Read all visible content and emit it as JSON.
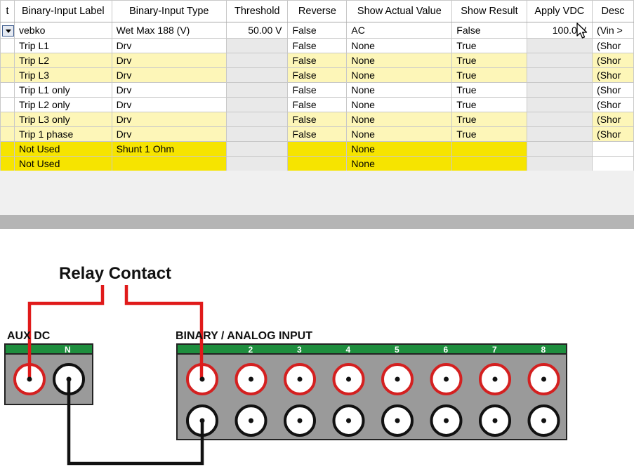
{
  "grid": {
    "columns": [
      "t",
      "Binary-Input Label",
      "Binary-Input Type",
      "Threshold",
      "Reverse",
      "Show Actual Value",
      "Show Result",
      "Apply VDC",
      "Desc"
    ],
    "rows": [
      {
        "style": "white",
        "label": "vebko",
        "type": "Wet Max 188 (V)",
        "threshold": "50.00 V",
        "reverse": "False",
        "actual": "AC",
        "result": "False",
        "vdc": "100.0 V",
        "desc": "(Vin >"
      },
      {
        "style": "white",
        "label": "Trip L1",
        "type": "Drv",
        "threshold": "",
        "reverse": "False",
        "actual": "None",
        "result": "True",
        "vdc": "",
        "desc": "(Shor"
      },
      {
        "style": "yellow",
        "label": "Trip L2",
        "type": "Drv",
        "threshold": "",
        "reverse": "False",
        "actual": "None",
        "result": "True",
        "vdc": "",
        "desc": "(Shor"
      },
      {
        "style": "yellow",
        "label": "Trip L3",
        "type": "Drv",
        "threshold": "",
        "reverse": "False",
        "actual": "None",
        "result": "True",
        "vdc": "",
        "desc": "(Shor"
      },
      {
        "style": "white",
        "label": "Trip L1 only",
        "type": "Drv",
        "threshold": "",
        "reverse": "False",
        "actual": "None",
        "result": "True",
        "vdc": "",
        "desc": "(Shor"
      },
      {
        "style": "white",
        "label": "Trip L2 only",
        "type": "Drv",
        "threshold": "",
        "reverse": "False",
        "actual": "None",
        "result": "True",
        "vdc": "",
        "desc": "(Shor"
      },
      {
        "style": "yellow",
        "label": "Trip L3 only",
        "type": "Drv",
        "threshold": "",
        "reverse": "False",
        "actual": "None",
        "result": "True",
        "vdc": "",
        "desc": "(Shor"
      },
      {
        "style": "yellow",
        "label": "Trip 1 phase",
        "type": "Drv",
        "threshold": "",
        "reverse": "False",
        "actual": "None",
        "result": "True",
        "vdc": "",
        "desc": "(Shor"
      },
      {
        "style": "gold",
        "label": "Not Used",
        "type": "Shunt 1 Ohm",
        "threshold": "",
        "reverse": "",
        "actual": "None",
        "result": "",
        "vdc": "",
        "desc": ""
      },
      {
        "style": "gold",
        "label": "Not Used",
        "type": "",
        "threshold": "",
        "reverse": "",
        "actual": "None",
        "result": "",
        "vdc": "",
        "desc": ""
      }
    ]
  },
  "diagram": {
    "title": "Relay Contact",
    "aux_label": "AUX DC",
    "aux_terminals": [
      "",
      "N"
    ],
    "input_label": "BINARY / ANALOG INPUT",
    "input_numbers": [
      "",
      "2",
      "3",
      "4",
      "5",
      "6",
      "7",
      "8"
    ],
    "colors": {
      "wire_red": "#e01a1a",
      "wire_black": "#111111",
      "strip_green": "#1e8e3e",
      "panel_gray": "#9a9a9a",
      "ring_red": "#d42020"
    }
  }
}
